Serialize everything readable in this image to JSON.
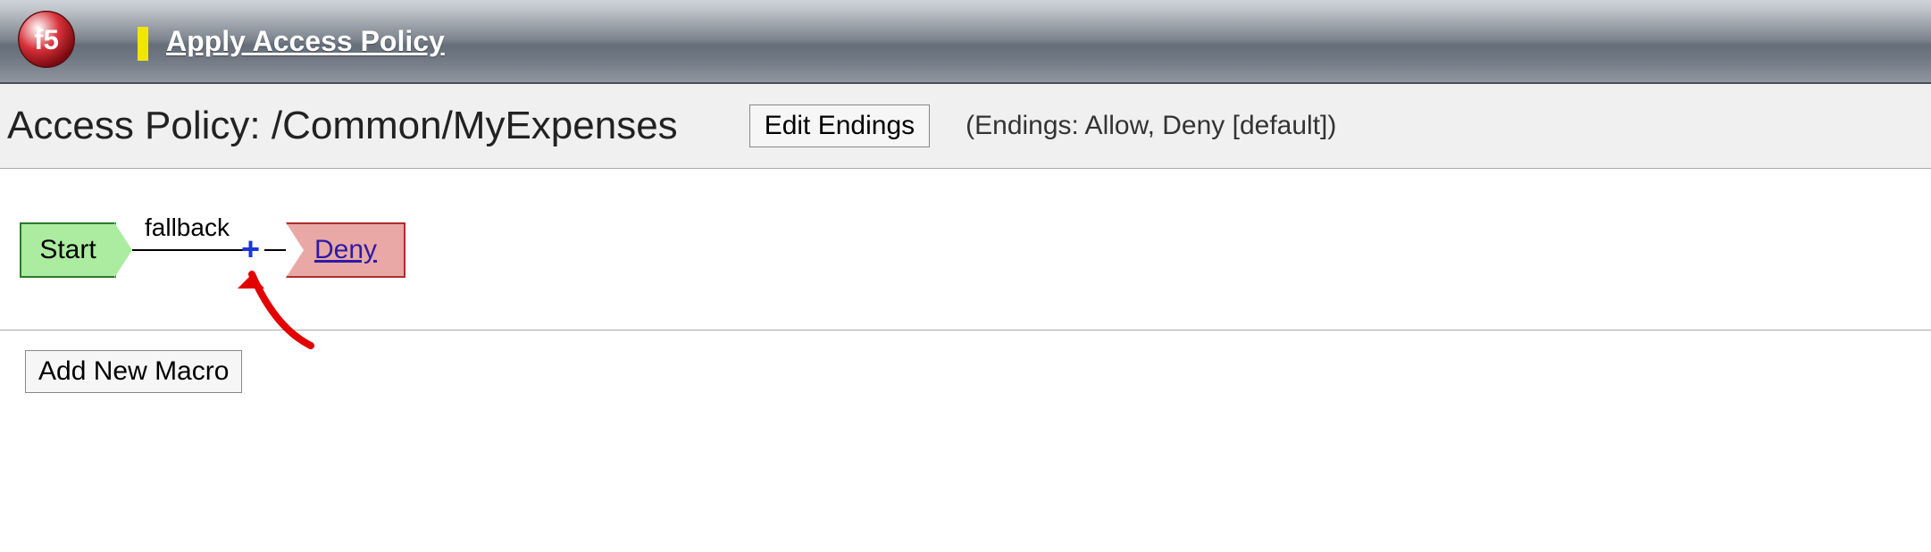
{
  "banner": {
    "apply_link": "Apply Access Policy"
  },
  "header": {
    "title": "Access Policy: /Common/MyExpenses",
    "edit_endings_btn": "Edit Endings",
    "endings_note": "(Endings: Allow, Deny [default])"
  },
  "flow": {
    "start_label": "Start",
    "branch_label": "fallback",
    "plus_glyph": "+",
    "end_label": "Deny"
  },
  "macro": {
    "add_btn": "Add New Macro"
  }
}
